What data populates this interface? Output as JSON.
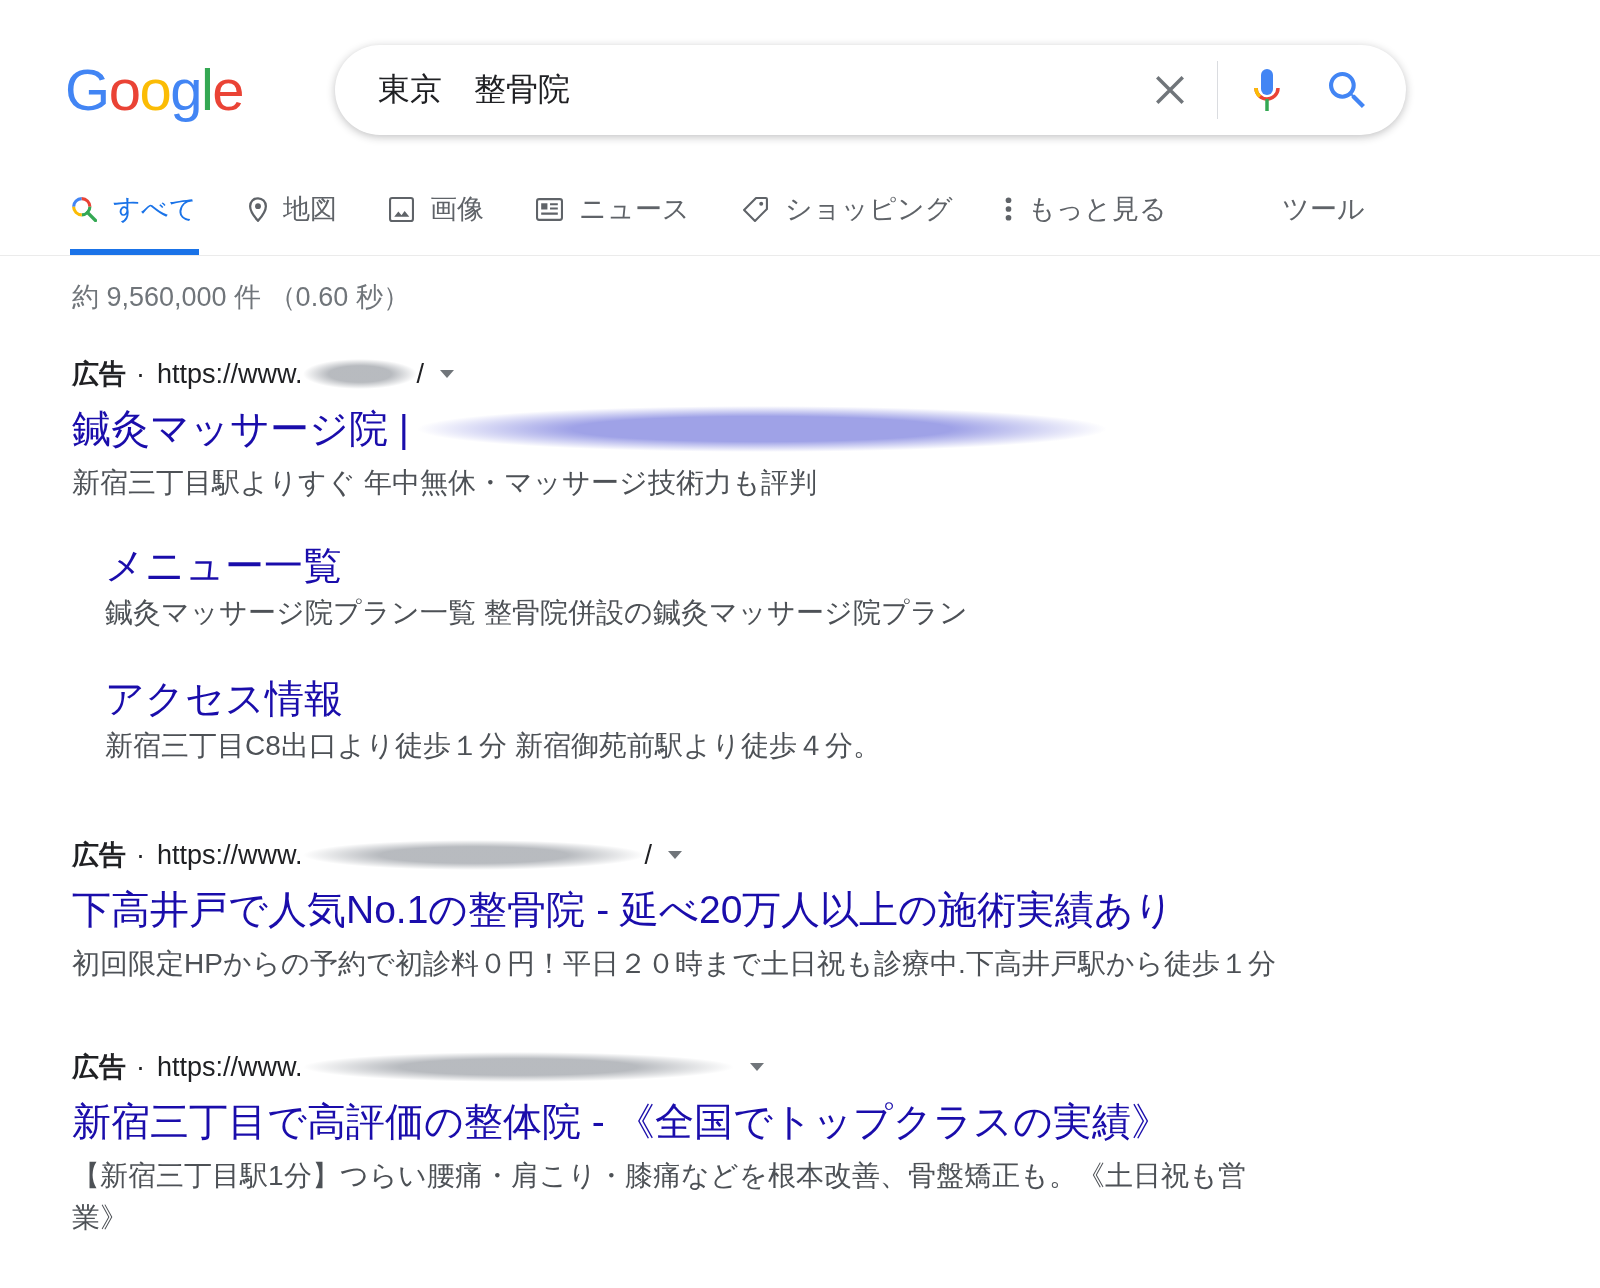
{
  "logo": {
    "text": "Google"
  },
  "search": {
    "value": "東京　整骨院"
  },
  "tabs": [
    {
      "label": "すべて",
      "kind": "all",
      "selected": true
    },
    {
      "label": "地図",
      "kind": "maps",
      "selected": false
    },
    {
      "label": "画像",
      "kind": "images",
      "selected": false
    },
    {
      "label": "ニュース",
      "kind": "news",
      "selected": false
    },
    {
      "label": "ショッピング",
      "kind": "shopping",
      "selected": false
    },
    {
      "label": "もっと見る",
      "kind": "more",
      "selected": false
    }
  ],
  "tools": {
    "label": "ツール"
  },
  "result_stats": "約 9,560,000 件 （0.60 秒）",
  "ads": [
    {
      "label": "広告",
      "separator": "·",
      "url": "https://www.",
      "url_blurred": true,
      "url_end": "/",
      "title": "鍼灸マッサージ院 |",
      "title_blurred": true,
      "description": "新宿三丁目駅よりすぐ 年中無休・マッサージ技術力も評判",
      "sitelinks": [
        {
          "title": "メニュー一覧",
          "description": "鍼灸マッサージ院プラン一覧 整骨院併設の鍼灸マッサージ院プラン"
        },
        {
          "title": "アクセス情報",
          "description": "新宿三丁目C8出口より徒歩１分 新宿御苑前駅より徒歩４分。"
        }
      ]
    },
    {
      "label": "広告",
      "separator": "·",
      "url": "https://www.",
      "url_blurred": true,
      "url_end": "/",
      "title": "下高井戸で人気No.1の整骨院 - 延べ20万人以上の施術実績あり",
      "description": "初回限定HPからの予約で初診料０円！平日２０時まで土日祝も診療中.下高井戸駅から徒歩１分"
    },
    {
      "label": "広告",
      "separator": "·",
      "url": "https://www.",
      "url_blurred": true,
      "title": "新宿三丁目で高評価の整体院 - 《全国でトップクラスの実績》",
      "description": "【新宿三丁目駅1分】つらい腰痛・肩こり・膝痛などを根本改善、骨盤矯正も。《土日祝も営業》"
    }
  ]
}
